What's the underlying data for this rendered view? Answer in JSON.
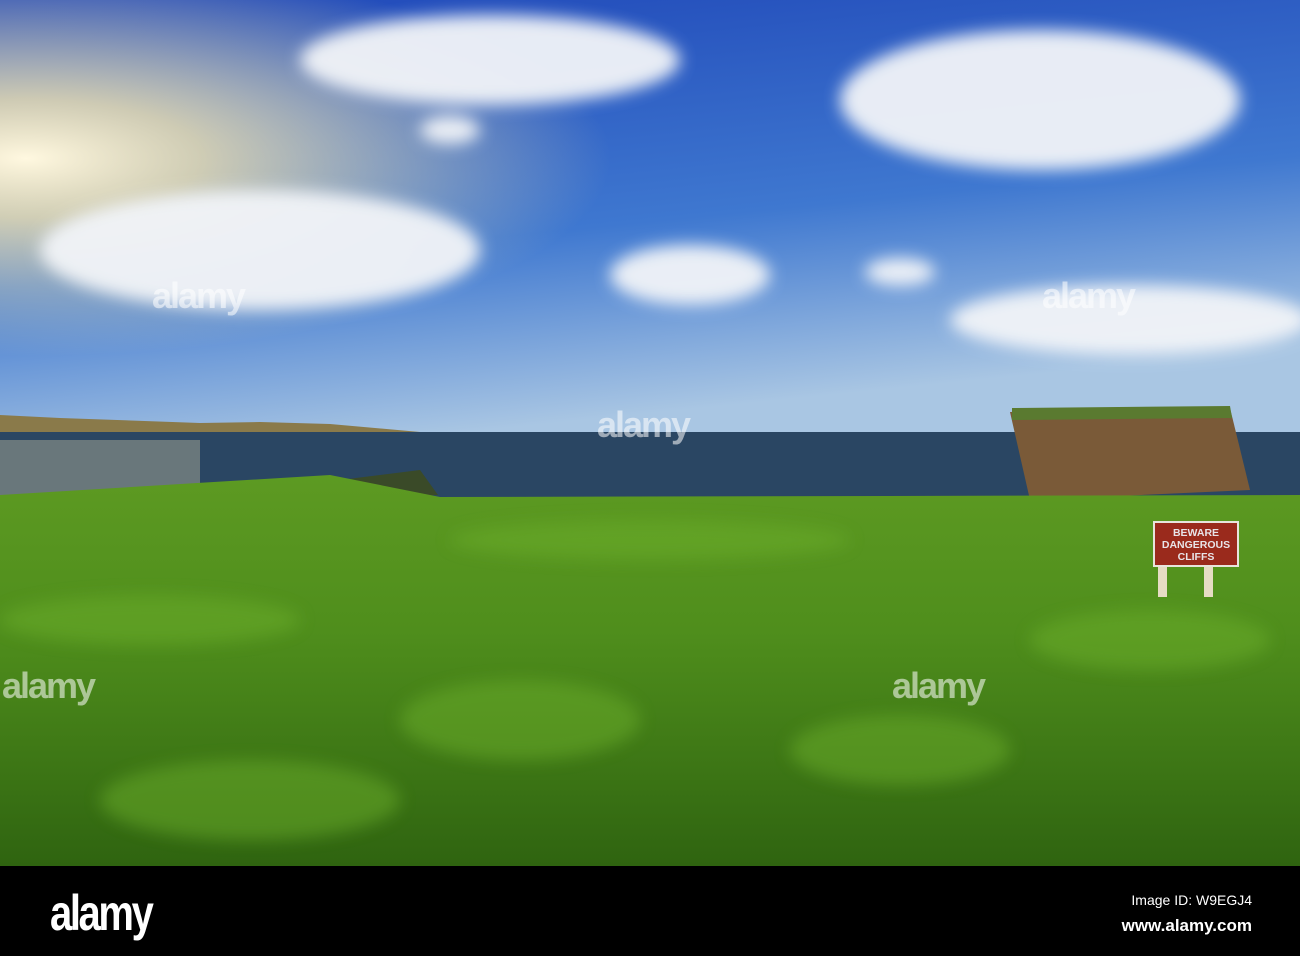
{
  "sign": {
    "line1": "BEWARE",
    "line2": "DANGEROUS",
    "line3": "CLIFFS"
  },
  "watermark": "alamy",
  "footer": {
    "logo": "alamy",
    "image_id": "Image ID: W9EGJ4",
    "url": "www.alamy.com"
  }
}
